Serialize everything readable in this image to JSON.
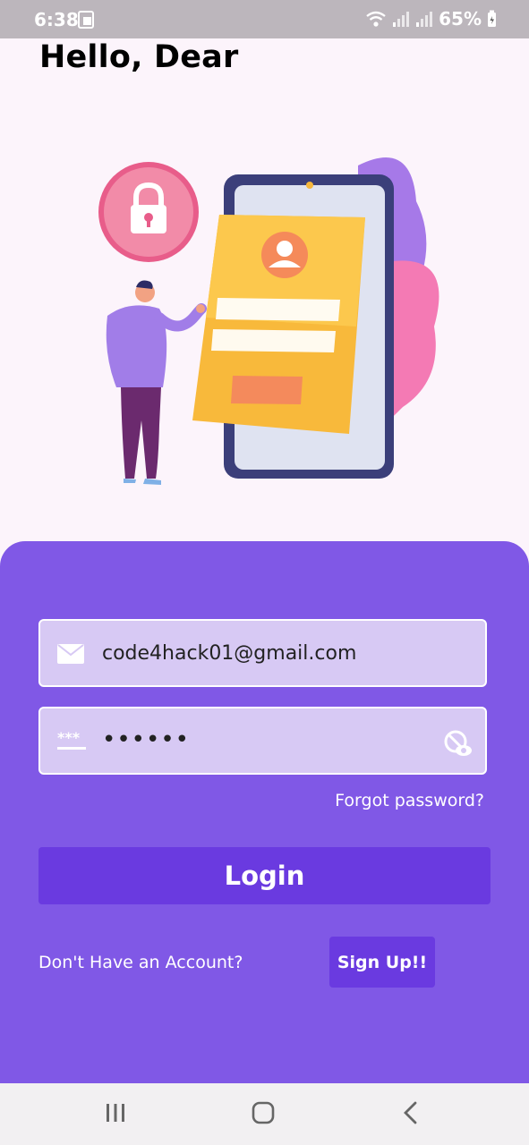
{
  "status_bar": {
    "time": "6:38",
    "battery": "65%"
  },
  "greeting": "Hello, Dear",
  "login_form": {
    "email_value": "code4hack01@gmail.com",
    "password_value": "••••••",
    "forgot_password": "Forgot password?",
    "login_label": "Login",
    "signup_prompt": "Don't Have an Account?",
    "signup_label": "Sign Up!!"
  },
  "colors": {
    "panel": "#8058e6",
    "field": "#d7c9f4",
    "button": "#6a3ae0",
    "page_background": "#fcf4fb"
  },
  "icons": [
    "mail-icon",
    "password-icon",
    "eye-toggle-icon",
    "lock-icon",
    "user-avatar-icon",
    "recent-apps-icon",
    "home-icon",
    "back-icon"
  ]
}
